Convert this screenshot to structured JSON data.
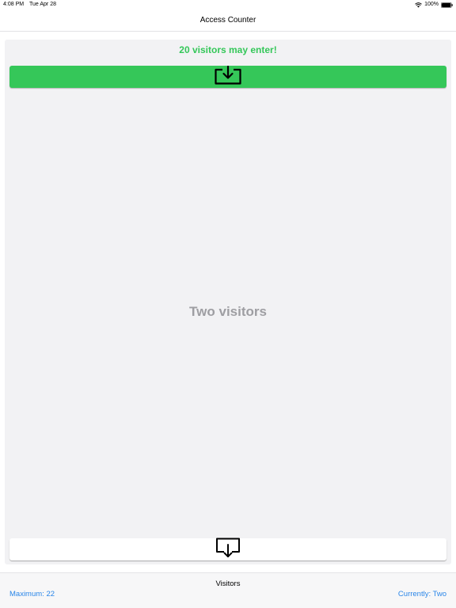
{
  "status_bar": {
    "time": "4:08 PM",
    "date": "Tue Apr 28",
    "battery": "100%",
    "icons": [
      "wifi-icon",
      "battery-icon"
    ]
  },
  "nav": {
    "title": "Access Counter"
  },
  "main": {
    "headline": "20 visitors may enter!",
    "count_text": "Two visitors",
    "enter_icon": "tray-arrow-down-icon",
    "exit_icon": "tray-arrow-out-icon"
  },
  "footer": {
    "title": "Visitors",
    "maximum": "Maximum: 22",
    "current": "Currently: Two"
  },
  "colors": {
    "accent_green": "#34c759",
    "link_blue": "#2a86e8",
    "muted_gray": "#9e9ea2",
    "panel_bg": "#f2f2f4"
  }
}
